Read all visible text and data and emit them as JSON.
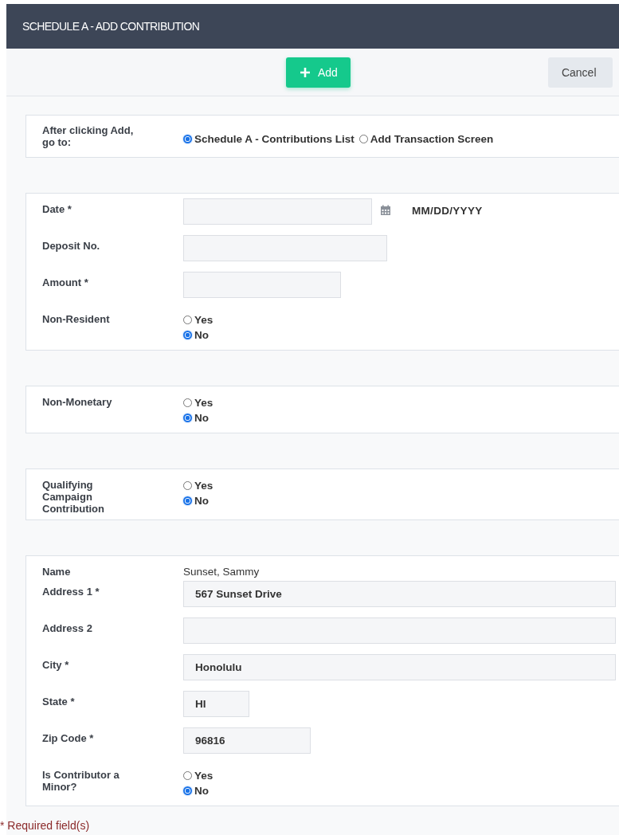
{
  "window": {
    "title": "SCHEDULE A - ADD CONTRIBUTION"
  },
  "toolbar": {
    "buttons": [
      {
        "label": "Add",
        "kind": "primary"
      },
      {
        "label": "Cancel",
        "kind": "secondary"
      }
    ]
  },
  "sections": [
    {
      "rows": [
        {
          "kind": "choice",
          "label": "After clicking Add, go to:",
          "options": [
            {
              "label": "Schedule A - Contributions List",
              "selected": true
            },
            {
              "label": "Add Transaction Screen",
              "selected": false
            }
          ]
        }
      ]
    },
    {
      "rows": [
        {
          "kind": "date",
          "label": "Date *",
          "hint": "MM/DD/YYYY"
        },
        {
          "kind": "text",
          "label": "Deposit No."
        },
        {
          "kind": "text",
          "label": "Amount *"
        },
        {
          "kind": "radio",
          "label": "Non-Resident",
          "options": [
            {
              "label": "Yes",
              "selected": false
            },
            {
              "label": "No",
              "selected": true
            }
          ]
        }
      ]
    },
    {
      "rows": [
        {
          "kind": "radio",
          "label": "Non-Monetary",
          "options": [
            {
              "label": "Yes",
              "selected": false
            },
            {
              "label": "No",
              "selected": true
            }
          ]
        }
      ]
    },
    {
      "rows": [
        {
          "kind": "radio",
          "label": "Qualifying Campaign Contribution",
          "options": [
            {
              "label": "Yes",
              "selected": false
            },
            {
              "label": "No",
              "selected": true
            }
          ]
        }
      ]
    },
    {
      "rows": [
        {
          "kind": "static",
          "label": "Name",
          "value": "Sunset, Sammy"
        },
        {
          "kind": "text",
          "label": "Address 1 *",
          "value": "567 Sunset Drive"
        },
        {
          "kind": "text",
          "label": "Address 2"
        },
        {
          "kind": "text",
          "label": "City *",
          "value": "Honolulu"
        },
        {
          "kind": "text",
          "label": "State *",
          "value": "HI"
        },
        {
          "kind": "text",
          "label": "Zip Code *",
          "value": "96816"
        },
        {
          "kind": "radio",
          "label": "Is Contributor a Minor?",
          "options": [
            {
              "label": "Yes",
              "selected": false
            },
            {
              "label": "No",
              "selected": true
            }
          ]
        }
      ]
    }
  ],
  "note": "* Required field(s)"
}
